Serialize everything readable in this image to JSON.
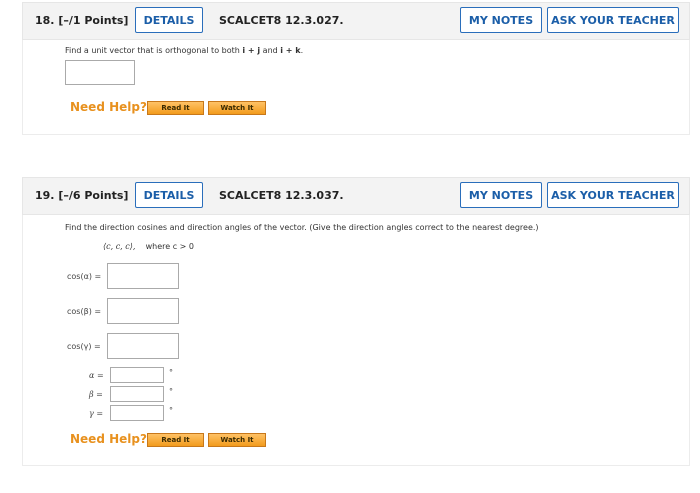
{
  "q18": {
    "number": "18.",
    "points": "[–/1 Points]",
    "details_label": "DETAILS",
    "source": "SCALCET8 12.3.027.",
    "my_notes_label": "MY NOTES",
    "ask_teacher_label": "ASK YOUR TEACHER",
    "prompt_prefix": "Find a unit vector that is orthogonal to both ",
    "vec1": "i + j",
    "prompt_mid": " and ",
    "vec2": "i + k",
    "prompt_suffix": ".",
    "answer_value": "",
    "need_help": "Need Help?",
    "read_it": "Read It",
    "watch_it": "Watch It"
  },
  "q19": {
    "number": "19.",
    "points": "[–/6 Points]",
    "details_label": "DETAILS",
    "source": "SCALCET8 12.3.037.",
    "my_notes_label": "MY NOTES",
    "ask_teacher_label": "ASK YOUR TEACHER",
    "prompt": "Find the direction cosines and direction angles of the vector. (Give the direction angles correct to the nearest degree.)",
    "vector": "⟨c, c, c⟩,",
    "condition": "where c > 0",
    "cos_alpha_label": "cos(α) =",
    "cos_beta_label": "cos(β) =",
    "cos_gamma_label": "cos(γ) =",
    "alpha_label": "α =",
    "beta_label": "β =",
    "gamma_label": "γ =",
    "degree_symbol": "°",
    "cos_alpha_value": "",
    "cos_beta_value": "",
    "cos_gamma_value": "",
    "alpha_value": "",
    "beta_value": "",
    "gamma_value": "",
    "need_help": "Need Help?",
    "read_it": "Read It",
    "watch_it": "Watch It"
  }
}
